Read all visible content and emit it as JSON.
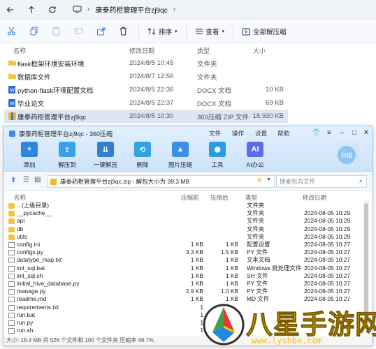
{
  "explorer": {
    "breadcrumb": [
      "康泰药柜管理平台zj9qc"
    ],
    "toolbar": {
      "sort_label": "排序",
      "view_label": "查看",
      "extract_all_label": "全部解压缩"
    },
    "columns": {
      "name": "名称",
      "date": "修改日期",
      "type": "类型",
      "size": "大小"
    },
    "files": [
      {
        "name": "flask框架环境安装环境",
        "date": "2024/8/5 10:45",
        "type": "文件夹",
        "size": "",
        "icon": "folder-icon"
      },
      {
        "name": "数据库文件",
        "date": "2024/8/7 12:56",
        "type": "文件夹",
        "size": "",
        "icon": "folder-icon"
      },
      {
        "name": "python-flask环境配置文档",
        "date": "2024/8/5 22:36",
        "type": "DOCX 文档",
        "size": "10 KB",
        "icon": "docx-icon"
      },
      {
        "name": "毕业论文",
        "date": "2024/8/5 22:37",
        "type": "DOCX 文档",
        "size": "69 KB",
        "icon": "docx-icon"
      },
      {
        "name": "康泰药柜管理平台zj9qc",
        "date": "2024/8/5 10:30",
        "type": "360压缩 ZIP 文件",
        "size": "18,930 KB",
        "icon": "zip-icon"
      }
    ]
  },
  "zip": {
    "title": "康泰药柜管理平台zj9qc - 360压缩",
    "menu": [
      "文件",
      "操作",
      "设置",
      "帮助"
    ],
    "tools": [
      {
        "label": "添加",
        "color": "#2e86de"
      },
      {
        "label": "解压到",
        "color": "#3aa0e8"
      },
      {
        "label": "一键解压",
        "color": "#2f7fd8"
      },
      {
        "label": "删除",
        "color": "#31a3e0"
      },
      {
        "label": "图片压缩",
        "color": "#3b8fe6"
      },
      {
        "label": "工具",
        "color": "#2a9be6"
      },
      {
        "label": "AI办公",
        "color": "#5b6ee8"
      }
    ],
    "scan_label": "扫描",
    "path": "康泰药柜管理平台zj9qc.zip - 解包大小为 39.3 MB",
    "search_placeholder": "搜索包内文件",
    "columns": {
      "name": "名称",
      "compressed": "压缩前",
      "original": "压缩后",
      "type": "类型",
      "date": "修改日期"
    },
    "rows": [
      {
        "name": ".. (上级目录)",
        "c": "",
        "o": "",
        "type": "文件夹",
        "date": "",
        "folder": true
      },
      {
        "name": "__pycache__",
        "c": "",
        "o": "",
        "type": "文件夹",
        "date": "2024-08-05 10:29",
        "folder": true
      },
      {
        "name": "api",
        "c": "",
        "o": "",
        "type": "文件夹",
        "date": "2024-08-05 10:29",
        "folder": true
      },
      {
        "name": "db",
        "c": "",
        "o": "",
        "type": "文件夹",
        "date": "2024-08-05 10:29",
        "folder": true
      },
      {
        "name": "utils",
        "c": "",
        "o": "",
        "type": "文件夹",
        "date": "2024-08-05 10:29",
        "folder": true
      },
      {
        "name": "config.ini",
        "c": "1 KB",
        "o": "1 KB",
        "type": "配置设置",
        "date": "2024-08-05 10:27",
        "folder": false
      },
      {
        "name": "configs.py",
        "c": "3.3 KB",
        "o": "1.5 KB",
        "type": "PY 文件",
        "date": "2024-08-05 10:27",
        "folder": false
      },
      {
        "name": "datatype_map.txt",
        "c": "1 KB",
        "o": "1 KB",
        "type": "文本文档",
        "date": "2024-08-05 10:27",
        "folder": false
      },
      {
        "name": "init_sql.bat",
        "c": "1 KB",
        "o": "1 KB",
        "type": "Windows 批处理文件",
        "date": "2024-08-05 10:27",
        "folder": false
      },
      {
        "name": "init_sql.sh",
        "c": "1 KB",
        "o": "1 KB",
        "type": "SH 文件",
        "date": "2024-08-05 10:27",
        "folder": false
      },
      {
        "name": "initial_hive_database.py",
        "c": "1 KB",
        "o": "1 KB",
        "type": "PY 文件",
        "date": "2024-08-05 10:27",
        "folder": false
      },
      {
        "name": "manage.py",
        "c": "2.9 KB",
        "o": "1.0 KB",
        "type": "PY 文件",
        "date": "2024-08-05 10:27",
        "folder": false
      },
      {
        "name": "readme.md",
        "c": "1 KB",
        "o": "1 KB",
        "type": "MD 文件",
        "date": "2024-08-05 10:27",
        "folder": false
      },
      {
        "name": "requirements.txt",
        "c": "1",
        "o": "",
        "type": "",
        "date": "",
        "folder": false
      },
      {
        "name": "run.bat",
        "c": "1",
        "o": "",
        "type": "",
        "date": "",
        "folder": false
      },
      {
        "name": "run.py",
        "c": "1",
        "o": "",
        "type": "",
        "date": "",
        "folder": false
      },
      {
        "name": "run.sh",
        "c": "1",
        "o": "",
        "type": "",
        "date": "",
        "folder": false
      }
    ],
    "status": "大小: 18.4 MB 共 526 个文件和 100 个文件夹 压缩率 46.7%"
  },
  "watermark": {
    "text": "八星手游网",
    "url": "www.lyshbx.com"
  }
}
